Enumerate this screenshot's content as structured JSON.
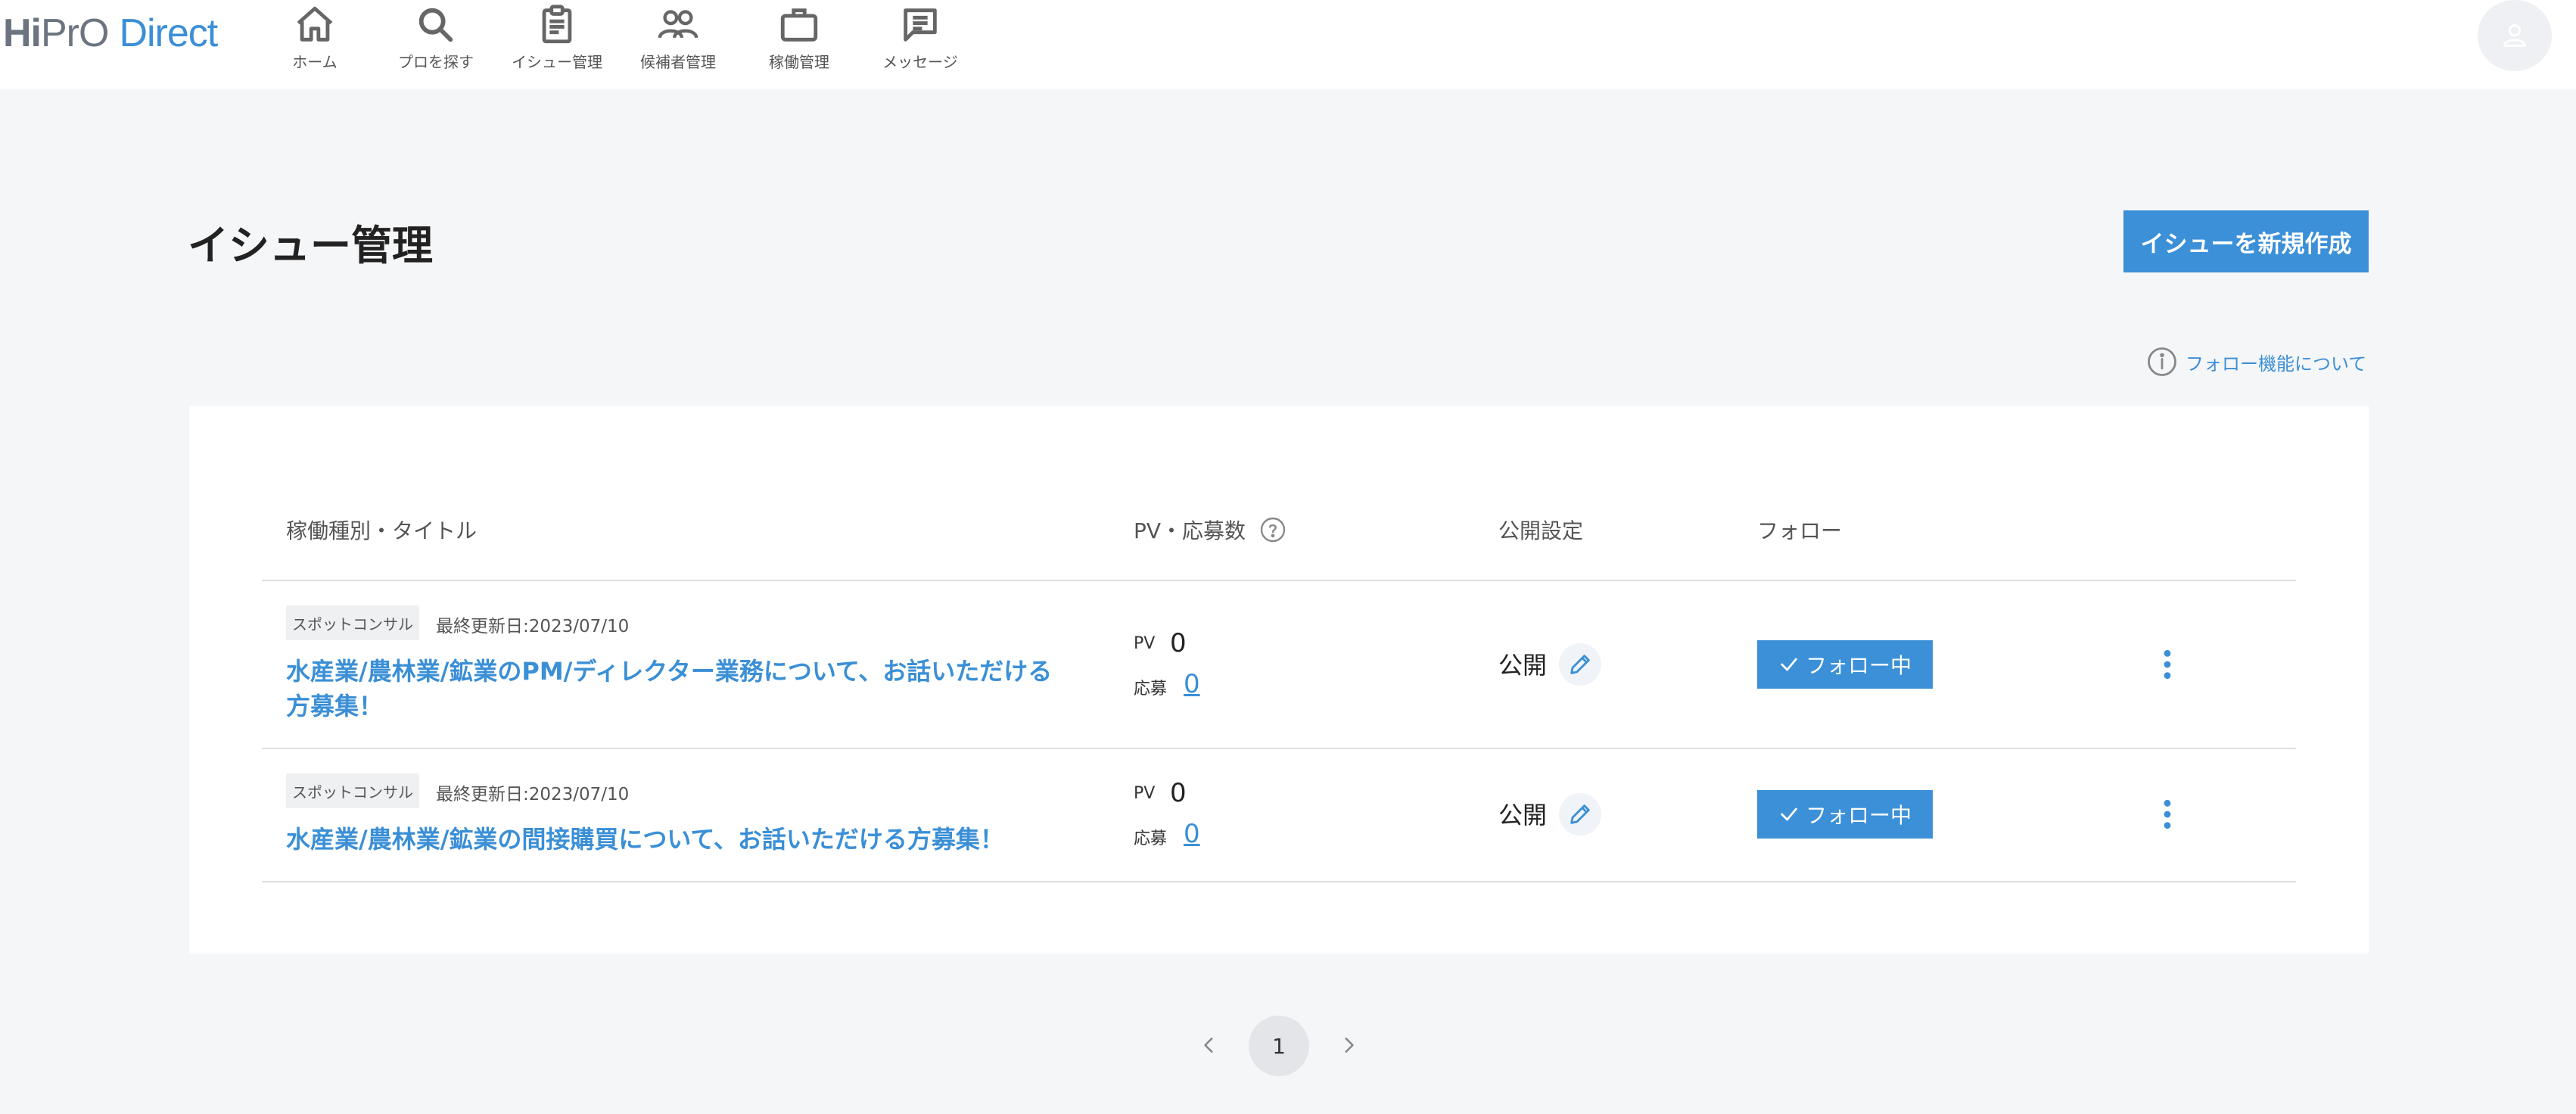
{
  "brand": {
    "logo_hi": "Hi",
    "logo_pro": "PrO",
    "logo_direct": "Direct"
  },
  "nav": {
    "items": [
      {
        "label": "ホーム",
        "icon": "home-icon"
      },
      {
        "label": "プロを探す",
        "icon": "search-icon"
      },
      {
        "label": "イシュー管理",
        "icon": "clipboard-icon"
      },
      {
        "label": "候補者管理",
        "icon": "users-icon"
      },
      {
        "label": "稼働管理",
        "icon": "briefcase-icon"
      },
      {
        "label": "メッセージ",
        "icon": "message-icon"
      }
    ]
  },
  "page": {
    "title": "イシュー管理",
    "create_button": "イシューを新規作成",
    "follow_help": "フォロー機能について"
  },
  "table": {
    "headers": {
      "title": "稼働種別・タイトル",
      "pv": "PV・応募数",
      "visibility": "公開設定",
      "follow": "フォロー"
    },
    "rows": [
      {
        "tag": "スポットコンサル",
        "updated": "最終更新日:2023/07/10",
        "title": "水産業/農林業/鉱業のPM/ディレクター業務について、お話いただける方募集！",
        "pv_label": "PV",
        "pv_value": "0",
        "apply_label": "応募",
        "apply_value": "0",
        "visibility": "公開",
        "follow_label": "フォロー中"
      },
      {
        "tag": "スポットコンサル",
        "updated": "最終更新日:2023/07/10",
        "title": "水産業/農林業/鉱業の間接購買について、お話いただける方募集！",
        "pv_label": "PV",
        "pv_value": "0",
        "apply_label": "応募",
        "apply_value": "0",
        "visibility": "公開",
        "follow_label": "フォロー中"
      }
    ]
  },
  "pagination": {
    "current": "1"
  },
  "colors": {
    "accent": "#3b90d8",
    "link": "#3b8fd6",
    "background": "#f5f6f8"
  }
}
